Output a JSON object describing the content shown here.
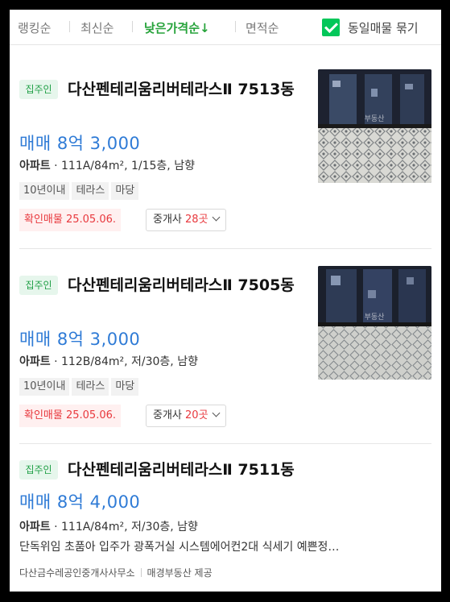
{
  "sort": {
    "options": [
      "랭킹순",
      "최신순",
      "낮은가격순↓",
      "면적순"
    ],
    "group_label": "동일매물 묶기",
    "group_checked": true
  },
  "listings": [
    {
      "badge": "집주인",
      "title": "다산펜테리움리버테라스Ⅱ 7513동",
      "price": "매매 8억 3,000",
      "type": "아파트",
      "spec": "111A/84m², 1/15층, 남향",
      "tags": [
        "10년이내",
        "테라스",
        "마당"
      ],
      "confirm": "확인매물 25.05.06.",
      "agent_label": "중개사",
      "agent_count": "28곳",
      "watermark": "부동산"
    },
    {
      "badge": "집주인",
      "title": "다산펜테리움리버테라스Ⅱ 7505동",
      "price": "매매 8억 3,000",
      "type": "아파트",
      "spec": "112B/84m², 저/30층, 남향",
      "tags": [
        "10년이내",
        "테라스",
        "마당"
      ],
      "confirm": "확인매물 25.05.06.",
      "agent_label": "중개사",
      "agent_count": "20곳",
      "watermark": "부동산"
    },
    {
      "badge": "집주인",
      "title": "다산펜테리움리버테라스Ⅱ 7511동",
      "price": "매매 8억 4,000",
      "type": "아파트",
      "spec": "111A/84m², 저/30층, 남향",
      "description": "단독위임 초품아 입주가 광폭거실 시스템에어컨2대 식세기 예쁜정…",
      "source_agent": "다산금수레공인중개사사무소",
      "source_provider": "매경부동산 제공"
    }
  ],
  "colors": {
    "accent_green": "#27a33b",
    "price_blue": "#2f7bd6",
    "confirm_red": "#e8383d"
  }
}
